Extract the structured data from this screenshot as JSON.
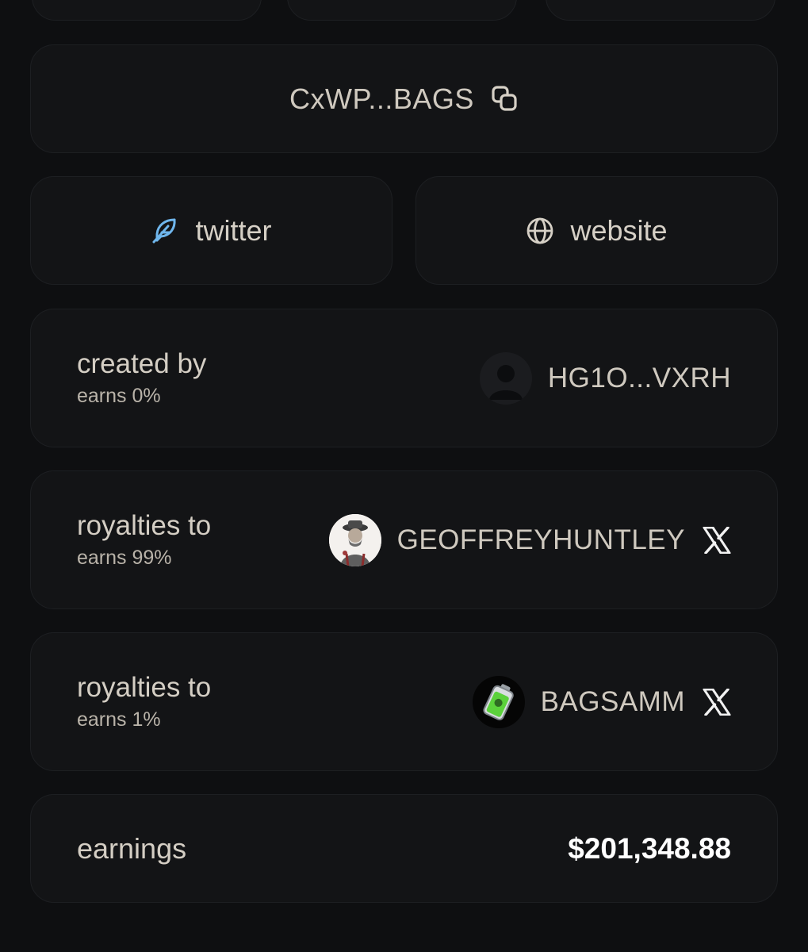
{
  "contract": {
    "address_short": "CxWP...BAGS",
    "copy_icon": "copy-icon"
  },
  "links": {
    "twitter_label": "twitter",
    "twitter_icon": "feather-icon",
    "twitter_color": "#6fb6ec",
    "website_label": "website",
    "website_icon": "globe-icon"
  },
  "creator": {
    "role": "created by",
    "earns": "earns 0%",
    "wallet": "HG1O...VXRH",
    "avatar_icon": "default-avatar-icon"
  },
  "royalties": [
    {
      "role": "royalties to",
      "earns": "earns 99%",
      "username": "GEOFFREYHUNTLEY",
      "avatar_icon": "profile-photo",
      "social_icon": "x-logo-icon"
    },
    {
      "role": "royalties to",
      "earns": "earns 1%",
      "username": "BAGSAMM",
      "avatar_icon": "battery-icon",
      "social_icon": "x-logo-icon"
    }
  ],
  "earnings": {
    "label": "earnings",
    "value": "$201,348.88"
  }
}
